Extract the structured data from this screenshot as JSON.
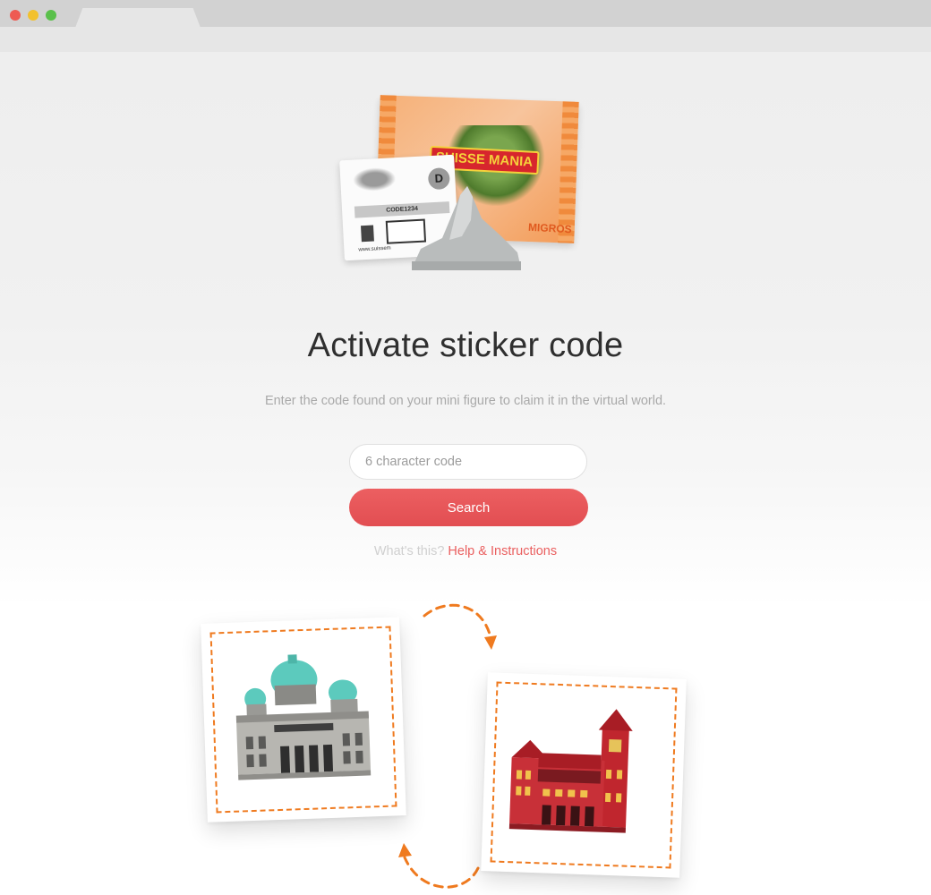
{
  "browser": {
    "buttons": {
      "close": "#ee5b52",
      "minimize": "#f2c12e",
      "maximize": "#5ac04b"
    }
  },
  "hero": {
    "pack_banner": "SUISSE MANIA",
    "pack_brand": "MIGROS",
    "card_letter": "D",
    "card_code": "CODE1234",
    "card_url": "www.suissem"
  },
  "main": {
    "title": "Activate sticker code",
    "subtitle": "Enter the code found on your mini figure to claim it in the virtual world.",
    "code_input": {
      "placeholder": "6 character code",
      "value": ""
    },
    "search_label": "Search",
    "help_question": "What's this?",
    "help_link": "Help & Instructions"
  },
  "colors": {
    "accent": "#e8575a",
    "link": "#ea5f5f",
    "dashed_border": "#ef7a1f",
    "title": "#2f2f2f",
    "subtitle": "#a9a9a9"
  },
  "illustrations": {
    "left_figure": "building-with-teal-domes",
    "right_figure": "red-town-hall-building",
    "arrows": [
      "curved-dashed-arrow-down",
      "curved-dashed-arrow-up"
    ]
  }
}
